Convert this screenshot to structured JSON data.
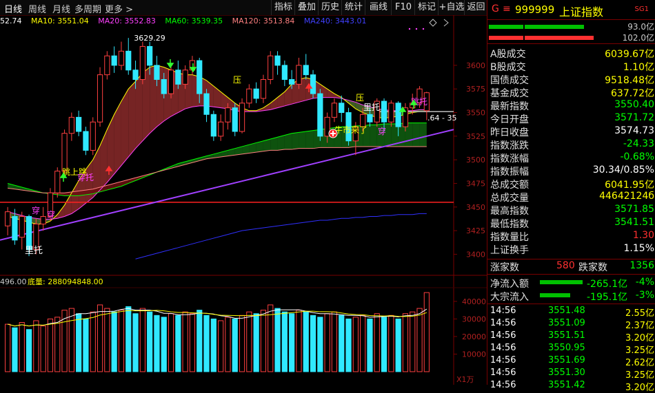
{
  "toolbar": {
    "periods": [
      "日线",
      "周线",
      "月线",
      "多周期",
      "更多 >"
    ],
    "tools": [
      "指标",
      "叠加",
      "历史",
      "统计",
      "画线",
      "F10",
      "标记",
      "+自选",
      "返回"
    ]
  },
  "ma_legend": [
    {
      "text": "52.74",
      "color": "#ffffff"
    },
    {
      "text": "MA10: 3551.04",
      "color": "#ffff00"
    },
    {
      "text": "MA20: 3552.83",
      "color": "#ff40ff"
    },
    {
      "text": "MA60: 3539.35",
      "color": "#00ff00"
    },
    {
      "text": "MA120: 3513.84",
      "color": "#ff8080"
    },
    {
      "text": "MA240: 3443.01",
      "color": "#4040ff"
    }
  ],
  "price_axis": [
    "3600",
    "3575",
    "3550",
    "3525",
    "3500",
    "3475",
    "3450",
    "3425",
    "3400"
  ],
  "volume_axis": [
    "40000",
    "30000",
    "20000",
    "10000"
  ],
  "volume_unit": "X1万",
  "volume_legend": {
    "left": "496.00",
    "label": "底量: 288094848.00"
  },
  "chart_annotations": {
    "high_label": "3629.29",
    "low_label": "里托",
    "marks": [
      "压",
      "压",
      "里托",
      "牛市来了",
      "穿",
      "穿",
      "穿",
      "跳上跳",
      "穿托",
      "跳托"
    ],
    "range_label": ".64 - 35"
  },
  "chart_data": {
    "type": "candlestick",
    "ylim": [
      3385,
      3640
    ],
    "horizontal_line": 3455,
    "candles": [
      {
        "o": 3430,
        "c": 3445,
        "h": 3450,
        "l": 3420
      },
      {
        "o": 3440,
        "c": 3415,
        "h": 3448,
        "l": 3410
      },
      {
        "o": 3418,
        "c": 3440,
        "h": 3445,
        "l": 3405
      },
      {
        "o": 3440,
        "c": 3405,
        "h": 3442,
        "l": 3398
      },
      {
        "o": 3405,
        "c": 3432,
        "h": 3438,
        "l": 3400
      },
      {
        "o": 3432,
        "c": 3440,
        "h": 3450,
        "l": 3425
      },
      {
        "o": 3440,
        "c": 3465,
        "h": 3470,
        "l": 3435
      },
      {
        "o": 3465,
        "c": 3488,
        "h": 3492,
        "l": 3460
      },
      {
        "o": 3488,
        "c": 3528,
        "h": 3532,
        "l": 3485
      },
      {
        "o": 3528,
        "c": 3545,
        "h": 3550,
        "l": 3520
      },
      {
        "o": 3545,
        "c": 3530,
        "h": 3552,
        "l": 3525
      },
      {
        "o": 3530,
        "c": 3510,
        "h": 3535,
        "l": 3505
      },
      {
        "o": 3510,
        "c": 3540,
        "h": 3545,
        "l": 3505
      },
      {
        "o": 3540,
        "c": 3590,
        "h": 3598,
        "l": 3535
      },
      {
        "o": 3590,
        "c": 3610,
        "h": 3615,
        "l": 3585
      },
      {
        "o": 3610,
        "c": 3600,
        "h": 3620,
        "l": 3592
      },
      {
        "o": 3600,
        "c": 3615,
        "h": 3625,
        "l": 3595
      },
      {
        "o": 3615,
        "c": 3595,
        "h": 3629,
        "l": 3590
      },
      {
        "o": 3595,
        "c": 3585,
        "h": 3605,
        "l": 3575
      },
      {
        "o": 3585,
        "c": 3620,
        "h": 3625,
        "l": 3580
      },
      {
        "o": 3620,
        "c": 3600,
        "h": 3625,
        "l": 3590
      },
      {
        "o": 3600,
        "c": 3585,
        "h": 3610,
        "l": 3578
      },
      {
        "o": 3585,
        "c": 3570,
        "h": 3592,
        "l": 3565
      },
      {
        "o": 3570,
        "c": 3595,
        "h": 3600,
        "l": 3565
      },
      {
        "o": 3595,
        "c": 3580,
        "h": 3605,
        "l": 3575
      },
      {
        "o": 3580,
        "c": 3595,
        "h": 3600,
        "l": 3575
      },
      {
        "o": 3595,
        "c": 3605,
        "h": 3610,
        "l": 3590
      },
      {
        "o": 3605,
        "c": 3570,
        "h": 3608,
        "l": 3560
      },
      {
        "o": 3570,
        "c": 3548,
        "h": 3575,
        "l": 3540
      },
      {
        "o": 3548,
        "c": 3525,
        "h": 3552,
        "l": 3520
      },
      {
        "o": 3525,
        "c": 3540,
        "h": 3548,
        "l": 3520
      },
      {
        "o": 3540,
        "c": 3555,
        "h": 3560,
        "l": 3532
      },
      {
        "o": 3555,
        "c": 3530,
        "h": 3560,
        "l": 3525
      },
      {
        "o": 3530,
        "c": 3560,
        "h": 3565,
        "l": 3528
      },
      {
        "o": 3560,
        "c": 3575,
        "h": 3580,
        "l": 3555
      },
      {
        "o": 3575,
        "c": 3565,
        "h": 3582,
        "l": 3560
      },
      {
        "o": 3565,
        "c": 3585,
        "h": 3590,
        "l": 3560
      },
      {
        "o": 3585,
        "c": 3610,
        "h": 3615,
        "l": 3580
      },
      {
        "o": 3610,
        "c": 3600,
        "h": 3615,
        "l": 3590
      },
      {
        "o": 3600,
        "c": 3585,
        "h": 3605,
        "l": 3578
      },
      {
        "o": 3585,
        "c": 3580,
        "h": 3595,
        "l": 3575
      },
      {
        "o": 3580,
        "c": 3600,
        "h": 3608,
        "l": 3575
      },
      {
        "o": 3600,
        "c": 3590,
        "h": 3612,
        "l": 3585
      },
      {
        "o": 3590,
        "c": 3570,
        "h": 3595,
        "l": 3565
      },
      {
        "o": 3570,
        "c": 3525,
        "h": 3575,
        "l": 3520
      },
      {
        "o": 3525,
        "c": 3545,
        "h": 3550,
        "l": 3518
      },
      {
        "o": 3545,
        "c": 3560,
        "h": 3565,
        "l": 3540
      },
      {
        "o": 3560,
        "c": 3550,
        "h": 3568,
        "l": 3540
      },
      {
        "o": 3550,
        "c": 3520,
        "h": 3555,
        "l": 3515
      },
      {
        "o": 3520,
        "c": 3535,
        "h": 3540,
        "l": 3505
      },
      {
        "o": 3535,
        "c": 3548,
        "h": 3555,
        "l": 3530
      },
      {
        "o": 3548,
        "c": 3540,
        "h": 3555,
        "l": 3535
      },
      {
        "o": 3540,
        "c": 3562,
        "h": 3565,
        "l": 3535
      },
      {
        "o": 3562,
        "c": 3540,
        "h": 3565,
        "l": 3530
      },
      {
        "o": 3540,
        "c": 3560,
        "h": 3563,
        "l": 3535
      },
      {
        "o": 3560,
        "c": 3535,
        "h": 3562,
        "l": 3525
      },
      {
        "o": 3535,
        "c": 3555,
        "h": 3560,
        "l": 3530
      },
      {
        "o": 3555,
        "c": 3560,
        "h": 3570,
        "l": 3548
      },
      {
        "o": 3560,
        "c": 3575,
        "h": 3578,
        "l": 3555
      },
      {
        "o": 3552,
        "c": 3571,
        "h": 3572,
        "l": 3542
      }
    ],
    "volumes": [
      27000,
      25000,
      28000,
      24000,
      29000,
      26000,
      30000,
      31000,
      35000,
      36000,
      33000,
      30000,
      34000,
      38000,
      36000,
      34000,
      35000,
      37000,
      33000,
      36000,
      34000,
      32000,
      31000,
      33000,
      32000,
      34000,
      33000,
      35000,
      32000,
      30000,
      29000,
      31000,
      30000,
      32000,
      34000,
      33000,
      35000,
      38000,
      36000,
      34000,
      33000,
      35000,
      34000,
      32000,
      31000,
      33000,
      34000,
      32000,
      30000,
      31000,
      32000,
      30000,
      33000,
      31000,
      32000,
      30000,
      33000,
      34000,
      36000,
      45000
    ],
    "ma10": [
      3440,
      3438,
      3436,
      3434,
      3432,
      3432,
      3435,
      3442,
      3452,
      3465,
      3478,
      3490,
      3500,
      3515,
      3532,
      3548,
      3562,
      3575,
      3583,
      3592,
      3598,
      3600,
      3598,
      3595,
      3592,
      3590,
      3590,
      3588,
      3584,
      3578,
      3572,
      3566,
      3560,
      3555,
      3552,
      3552,
      3555,
      3560,
      3566,
      3572,
      3580,
      3585,
      3587,
      3585,
      3580,
      3575,
      3570,
      3566,
      3560,
      3554,
      3550,
      3547,
      3545,
      3544,
      3545,
      3546,
      3548,
      3550,
      3551,
      3551
    ],
    "ma20": [
      3445,
      3443,
      3441,
      3439,
      3438,
      3437,
      3437,
      3438,
      3440,
      3443,
      3448,
      3454,
      3460,
      3468,
      3476,
      3485,
      3494,
      3503,
      3512,
      3520,
      3528,
      3535,
      3541,
      3546,
      3550,
      3554,
      3556,
      3557,
      3557,
      3556,
      3555,
      3554,
      3552,
      3551,
      3551,
      3551,
      3552,
      3553,
      3555,
      3557,
      3559,
      3561,
      3563,
      3565,
      3566,
      3566,
      3566,
      3565,
      3563,
      3561,
      3558,
      3556,
      3554,
      3553,
      3552,
      3552,
      3552,
      3552,
      3553,
      3553
    ],
    "ma60": [
      3475,
      3473,
      3471,
      3469,
      3467,
      3465,
      3464,
      3463,
      3462,
      3462,
      3462,
      3463,
      3464,
      3466,
      3468,
      3470,
      3472,
      3475,
      3478,
      3481,
      3484,
      3487,
      3490,
      3493,
      3496,
      3498,
      3500,
      3502,
      3504,
      3506,
      3508,
      3510,
      3512,
      3514,
      3516,
      3518,
      3520,
      3522,
      3524,
      3526,
      3528,
      3529,
      3530,
      3531,
      3532,
      3533,
      3534,
      3535,
      3535,
      3536,
      3536,
      3537,
      3537,
      3538,
      3538,
      3538,
      3539,
      3539,
      3539,
      3539
    ],
    "ma120": [
      3470,
      3469,
      3468,
      3467,
      3466,
      3465,
      3465,
      3465,
      3465,
      3466,
      3467,
      3468,
      3469,
      3471,
      3473,
      3475,
      3477,
      3479,
      3481,
      3483,
      3485,
      3487,
      3489,
      3491,
      3493,
      3495,
      3497,
      3499,
      3501,
      3502,
      3503,
      3504,
      3505,
      3506,
      3507,
      3508,
      3509,
      3510,
      3510,
      3511,
      3511,
      3512,
      3512,
      3512,
      3513,
      3513,
      3513,
      3513,
      3513,
      3514,
      3514,
      3514,
      3514,
      3514,
      3514,
      3514,
      3514,
      3514,
      3514,
      3514
    ],
    "ma240": [
      null,
      null,
      null,
      null,
      null,
      null,
      null,
      null,
      null,
      null,
      null,
      null,
      null,
      null,
      null,
      null,
      null,
      null,
      3395,
      3397,
      3399,
      3401,
      3403,
      3405,
      3407,
      3409,
      3411,
      3413,
      3415,
      3417,
      3419,
      3421,
      3423,
      3425,
      3426,
      3427,
      3428,
      3429,
      3430,
      3431,
      3432,
      3433,
      3434,
      3435,
      3436,
      3436,
      3437,
      3438,
      3438,
      3439,
      3439,
      3440,
      3440,
      3441,
      3441,
      3442,
      3442,
      3442,
      3443,
      3443
    ]
  },
  "right_panel": {
    "title": {
      "market": "G",
      "code": "999999",
      "name": "上证指数",
      "tag": "SG1"
    },
    "bars": [
      {
        "value": "93.0亿"
      },
      {
        "value": "102.0亿"
      }
    ],
    "stats": [
      {
        "label": "A股成交",
        "value": "6039.67亿",
        "color": "#ffff00"
      },
      {
        "label": "B股成交",
        "value": "1.10亿",
        "color": "#ffff00"
      },
      {
        "label": "国债成交",
        "value": "9518.48亿",
        "color": "#ffff00"
      },
      {
        "label": "基金成交",
        "value": "637.72亿",
        "color": "#ffff00"
      },
      {
        "label": "最新指数",
        "value": "3550.40",
        "color": "#00ff00"
      },
      {
        "label": "今日开盘",
        "value": "3571.72",
        "color": "#00ff00"
      },
      {
        "label": "昨日收盘",
        "value": "3574.73",
        "color": "#ffffff"
      },
      {
        "label": "指数涨跌",
        "value": "-24.33",
        "color": "#00ff00"
      },
      {
        "label": "指数涨幅",
        "value": "-0.68%",
        "color": "#00ff00"
      },
      {
        "label": "指数振幅",
        "value": "30.34/0.85%",
        "color": "#ffffff"
      },
      {
        "label": "总成交额",
        "value": "6041.95亿",
        "color": "#ffff00"
      },
      {
        "label": "总成交量",
        "value": "44642124б",
        "color": "#ffff00"
      },
      {
        "label": "最高指数",
        "value": "3571.85",
        "color": "#00ff00"
      },
      {
        "label": "最低指数",
        "value": "3541.51",
        "color": "#00ff00"
      },
      {
        "label": "指数量比",
        "value": "1.30",
        "color": "#ff3030"
      },
      {
        "label": "上证换手",
        "value": "1.15%",
        "color": "#ffffff"
      }
    ],
    "updown": {
      "up_label": "涨家数",
      "up_value": "580",
      "down_label": "跌家数",
      "down_value": "1356"
    },
    "flows": [
      {
        "label": "净流入额",
        "value": "-265.1亿",
        "pct": "-4%"
      },
      {
        "label": "大宗流入",
        "value": "-195.1亿",
        "pct": "-3%"
      }
    ],
    "ticks": [
      {
        "time": "14:56",
        "price": "3551.48",
        "amount": "2.55亿"
      },
      {
        "time": "14:56",
        "price": "3551.09",
        "amount": "2.37亿"
      },
      {
        "time": "14:56",
        "price": "3551.51",
        "amount": "3.20亿"
      },
      {
        "time": "14:56",
        "price": "3550.95",
        "amount": "3.25亿"
      },
      {
        "time": "14:56",
        "price": "3551.69",
        "amount": "2.62亿"
      },
      {
        "time": "14:56",
        "price": "3551.30",
        "amount": "3.25亿"
      },
      {
        "time": "14:56",
        "price": "3551.42",
        "amount": "3.20亿"
      }
    ]
  }
}
